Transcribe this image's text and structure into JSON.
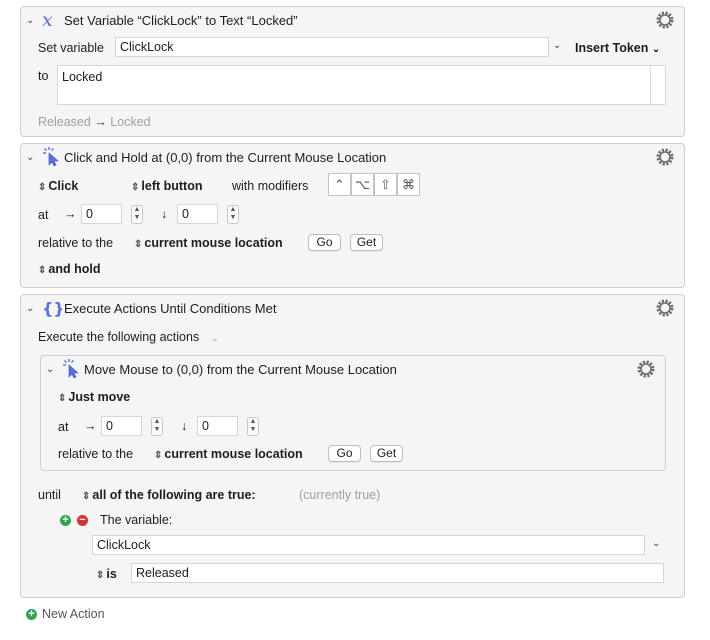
{
  "actions": {
    "set_variable": {
      "title": "Set Variable “ClickLock” to Text “Locked”",
      "set_variable_label": "Set variable",
      "variable_name": "ClickLock",
      "insert_token": "Insert Token",
      "to_label": "to",
      "to_value": "Locked",
      "status_from": "Released",
      "status_arrow": "→",
      "status_to": "Locked"
    },
    "click_hold": {
      "title": "Click and Hold at (0,0) from the Current Mouse Location",
      "click_type": "Click",
      "button": "left button",
      "with_modifiers": "with modifiers",
      "modifiers": [
        "⌃",
        "⌥",
        "⇧",
        "⌘"
      ],
      "at_label": "at",
      "x_arrow": "→",
      "x_value": "0",
      "y_arrow": "↓",
      "y_value": "0",
      "relative_label": "relative to the",
      "relative_value": "current mouse location",
      "go": "Go",
      "get": "Get",
      "hold_mode": "and hold"
    },
    "execute_until": {
      "title": "Execute Actions Until Conditions Met",
      "execute_label": "Execute the following actions",
      "nested": {
        "title": "Move Mouse to (0,0) from the Current Mouse Location",
        "mode": "Just move",
        "at_label": "at",
        "x_arrow": "→",
        "x_value": "0",
        "y_arrow": "↓",
        "y_value": "0",
        "relative_label": "relative to the",
        "relative_value": "current mouse location",
        "go": "Go",
        "get": "Get"
      },
      "until_label": "until",
      "condition_mode": "all of the following are true:",
      "currently": "(currently true)",
      "condition_type": "The variable:",
      "condition_variable": "ClickLock",
      "operator": "is",
      "compare_value": "Released"
    }
  },
  "footer": {
    "new_action": "New Action"
  },
  "colors": {
    "accent": "#5b6ee1",
    "gear": "#6e6e6e",
    "add": "#2ea44f",
    "remove": "#d93030"
  }
}
